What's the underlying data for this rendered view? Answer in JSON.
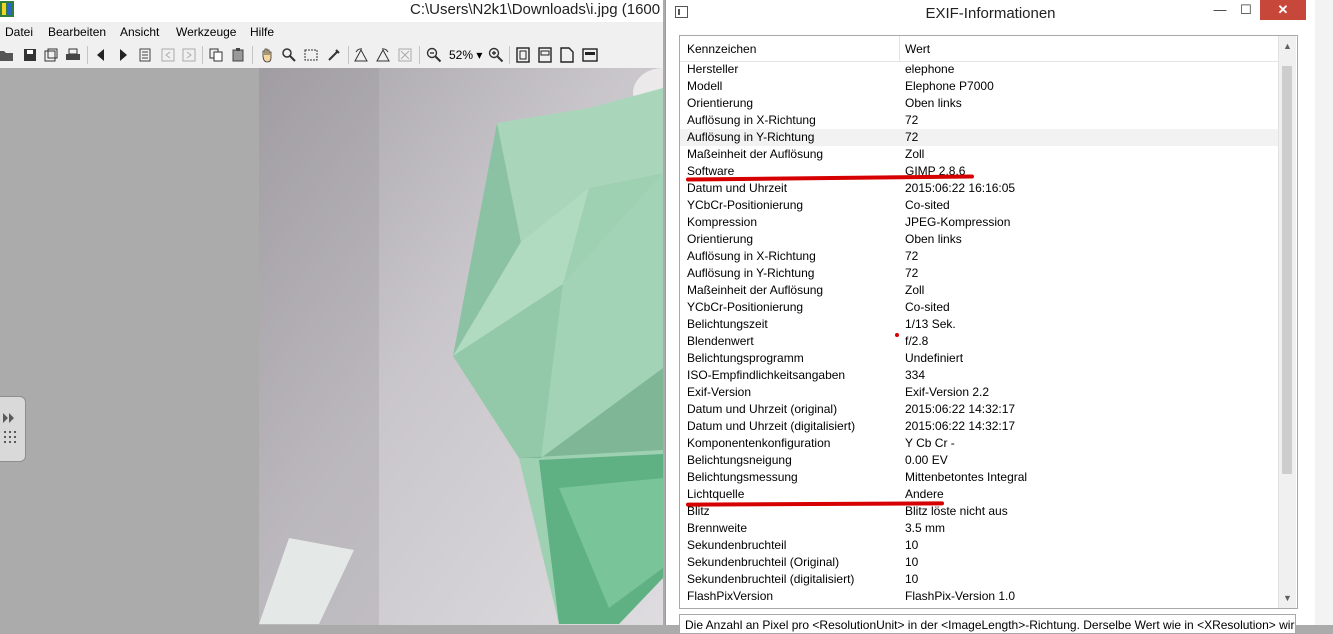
{
  "viewer": {
    "title": "C:\\Users\\N2k1\\Downloads\\i.jpg (1600",
    "menu": [
      "Datei",
      "Bearbeiten",
      "Ansicht",
      "Werkzeuge",
      "Hilfe"
    ],
    "zoom": "52%"
  },
  "exif": {
    "title": "EXIF-Informationen",
    "columns": {
      "key": "Kennzeichen",
      "value": "Wert"
    },
    "rows": [
      {
        "key": "Hersteller",
        "value": "elephone"
      },
      {
        "key": "Modell",
        "value": "Elephone P7000"
      },
      {
        "key": "Orientierung",
        "value": "Oben links"
      },
      {
        "key": "Auflösung in X-Richtung",
        "value": "72"
      },
      {
        "key": "Auflösung in Y-Richtung",
        "value": "72"
      },
      {
        "key": "Maßeinheit der Auflösung",
        "value": "Zoll"
      },
      {
        "key": "Software",
        "value": "GIMP 2.8.6"
      },
      {
        "key": "Datum und Uhrzeit",
        "value": "2015:06:22 16:16:05"
      },
      {
        "key": "YCbCr-Positionierung",
        "value": "Co-sited"
      },
      {
        "key": "Kompression",
        "value": "JPEG-Kompression"
      },
      {
        "key": "Orientierung",
        "value": "Oben links"
      },
      {
        "key": "Auflösung in X-Richtung",
        "value": "72"
      },
      {
        "key": "Auflösung in Y-Richtung",
        "value": "72"
      },
      {
        "key": "Maßeinheit der Auflösung",
        "value": "Zoll"
      },
      {
        "key": "YCbCr-Positionierung",
        "value": "Co-sited"
      },
      {
        "key": "Belichtungszeit",
        "value": "1/13 Sek."
      },
      {
        "key": "Blendenwert",
        "value": "f/2.8"
      },
      {
        "key": "Belichtungsprogramm",
        "value": "Undefiniert"
      },
      {
        "key": "ISO-Empfindlichkeitsangaben",
        "value": "334"
      },
      {
        "key": "Exif-Version",
        "value": "Exif-Version 2.2"
      },
      {
        "key": "Datum und Uhrzeit (original)",
        "value": "2015:06:22 14:32:17"
      },
      {
        "key": "Datum und Uhrzeit (digitalisiert)",
        "value": "2015:06:22 14:32:17"
      },
      {
        "key": "Komponentenkonfiguration",
        "value": "Y Cb Cr -"
      },
      {
        "key": "Belichtungsneigung",
        "value": "0.00 EV"
      },
      {
        "key": "Belichtungsmessung",
        "value": "Mittenbetontes Integral"
      },
      {
        "key": "Lichtquelle",
        "value": "Andere"
      },
      {
        "key": "Blitz",
        "value": "Blitz löste nicht aus"
      },
      {
        "key": "Brennweite",
        "value": "3.5 mm"
      },
      {
        "key": "Sekundenbruchteil",
        "value": "10"
      },
      {
        "key": "Sekundenbruchteil  (Original)",
        "value": "10"
      },
      {
        "key": "Sekundenbruchteil (digitalisiert)",
        "value": "10"
      },
      {
        "key": "FlashPixVersion",
        "value": "FlashPix-Version 1.0"
      }
    ],
    "description": "Die Anzahl an Pixel pro <ResolutionUnit> in der <ImageLength>-Richtung. Derselbe Wert wie in <XResolution> wird"
  },
  "colors": {
    "annotation": "#d60000",
    "close": "#c7473b",
    "lamp": "#8fcaa7"
  }
}
